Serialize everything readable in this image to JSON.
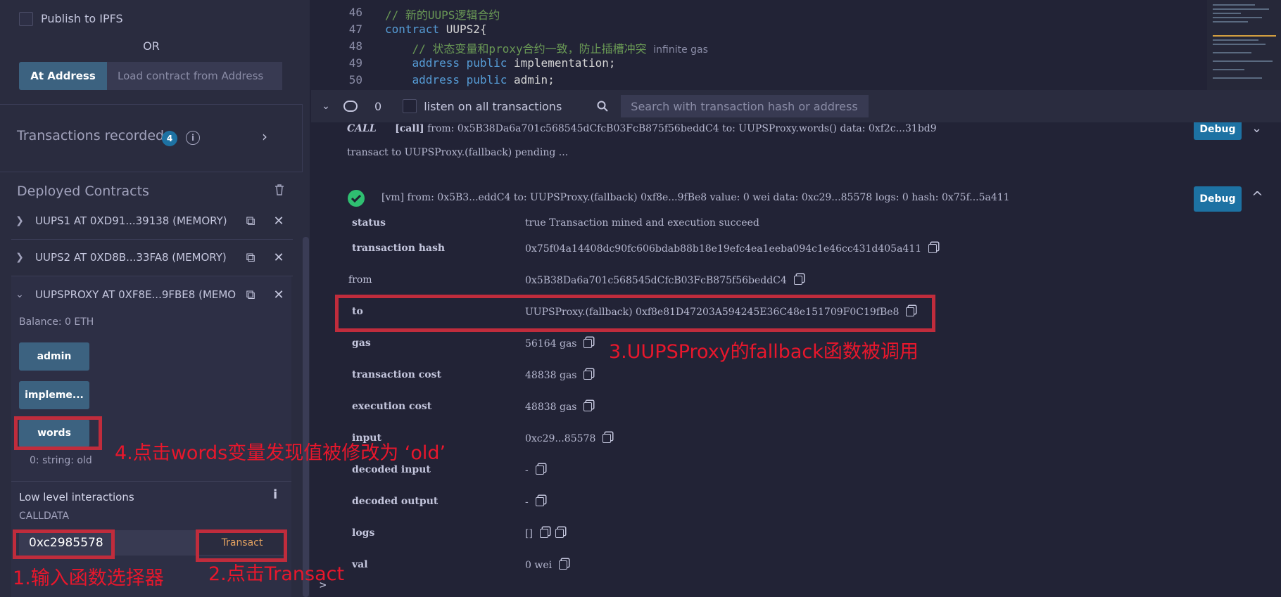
{
  "left": {
    "publish_ipfs_label": "Publish to IPFS",
    "or_label": "OR",
    "at_address_button": "At Address",
    "load_contract_placeholder": "Load contract from Address",
    "transactions_recorded_label": "Transactions recorded",
    "transactions_recorded_count": "4",
    "deployed_contracts_title": "Deployed Contracts",
    "contracts": [
      {
        "label": "UUPS1 AT 0XD91...39138 (MEMORY)",
        "expanded": false
      },
      {
        "label": "UUPS2 AT 0XD8B...33FA8 (MEMORY)",
        "expanded": false
      },
      {
        "label": "UUPSPROXY AT 0XF8E...9FBE8 (MEMO",
        "expanded": true
      }
    ],
    "balance": "Balance: 0 ETH",
    "function_buttons": [
      "admin",
      "impleme...",
      "words"
    ],
    "words_result": "0: string: old",
    "low_level_title": "Low level interactions",
    "calldata_label": "CALLDATA",
    "calldata_value": "0xc2985578",
    "transact_button": "Transact"
  },
  "editor": {
    "lines": [
      {
        "num": "46",
        "comment": "// 新的UUPS逻辑合约"
      },
      {
        "num": "47",
        "keyword": "contract",
        "ident": " UUPS2{"
      },
      {
        "num": "48",
        "comment": "    // 状态变量和proxy合约一致，防止插槽冲突",
        "hint": "infinite gas"
      },
      {
        "num": "49",
        "keyword": "    address public",
        "ident": " implementation;"
      },
      {
        "num": "50",
        "keyword": "    address public",
        "ident": " admin;"
      }
    ]
  },
  "terminal_bar": {
    "pending_count": "0",
    "listen_label": "listen on all transactions",
    "search_placeholder": "Search with transaction hash or address"
  },
  "terminal": {
    "call_line": {
      "tag": "CALL",
      "prefix": "[call]",
      "text": " from: 0x5B38Da6a701c568545dCfcB03FcB875f56beddC4 to: UUPSProxy.words() data: 0xf2c...31bd9"
    },
    "pending_line": "transact to UUPSProxy.(fallback) pending ...",
    "vm_line": "[vm]  from: 0x5B3...eddC4 to: UUPSProxy.(fallback) 0xf8e...9fBe8 value: 0 wei data: 0xc29...85578 logs: 0 hash: 0x75f...5a411",
    "debug_label": "Debug",
    "rows": [
      {
        "label": "status",
        "value": "true Transaction mined and execution succeed",
        "copy": false
      },
      {
        "label": "transaction hash",
        "value": "0x75f04a14408dc90fc606bdab88b18e19efc4ea1eeba094c1e46cc431d405a411",
        "copy": true
      },
      {
        "label": "from",
        "value": "0x5B38Da6a701c568545dCfcB03FcB875f56beddC4",
        "copy": true
      },
      {
        "label": "to",
        "value": "UUPSProxy.(fallback) 0xf8e81D47203A594245E36C48e151709F0C19fBe8",
        "copy": true
      },
      {
        "label": "gas",
        "value": "56164 gas",
        "copy": true
      },
      {
        "label": "transaction cost",
        "value": "48838 gas",
        "copy": true
      },
      {
        "label": "execution cost",
        "value": "48838 gas",
        "copy": true
      },
      {
        "label": "input",
        "value": "0xc29...85578",
        "copy": true
      },
      {
        "label": "decoded input",
        "value": "-",
        "copy": true
      },
      {
        "label": "decoded output",
        "value": " -",
        "copy": true
      },
      {
        "label": "logs",
        "value": "[]",
        "copy": true
      },
      {
        "label": "val",
        "value": "0 wei",
        "copy": true
      }
    ],
    "prompt": ">"
  },
  "annotations": {
    "step1": "1.输入函数选择器",
    "step2": "2.点击Transact",
    "step3": "3.UUPSProxy的fallback函数被调用",
    "step4": "4.点击words变量发现值被修改为 ‘old’"
  },
  "colors": {
    "annotation_red": "#e8172c",
    "debug_blue": "#1d72a3",
    "success_green": "#2fbf71",
    "badge_blue": "#1d72a3",
    "transact_orange": "#e0a060"
  }
}
